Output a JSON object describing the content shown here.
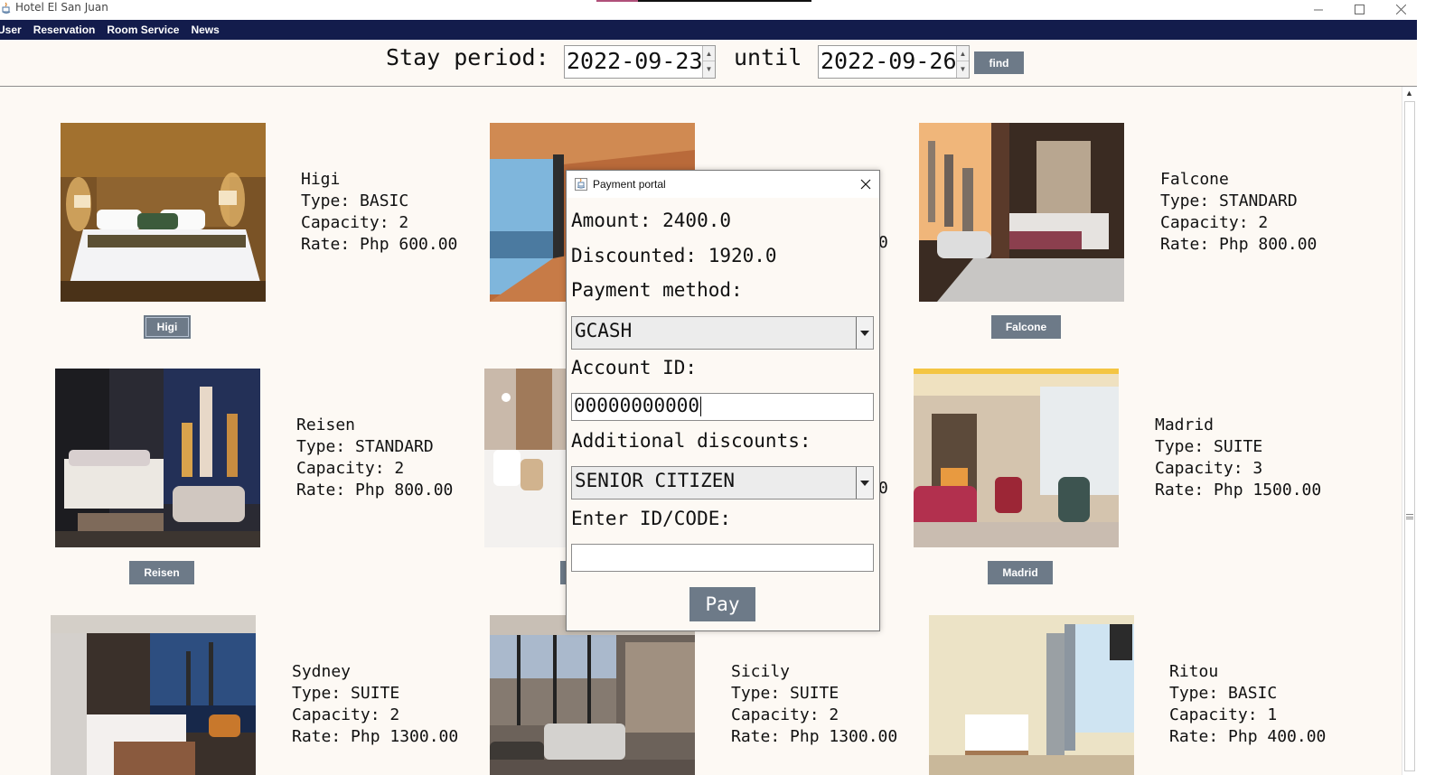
{
  "window": {
    "title": "Hotel El San Juan"
  },
  "menu": {
    "items": [
      "User",
      "Reservation",
      "Room Service",
      "News"
    ]
  },
  "search": {
    "stay_label": "Stay period:",
    "from_date": "2022-09-23",
    "until_label": "until",
    "to_date": "2022-09-26",
    "find_label": "find"
  },
  "rooms": [
    {
      "name": "Higi",
      "info": "Higi\nType: BASIC\nCapacity: 2\nRate: Php 600.00",
      "button": "Higi"
    },
    {
      "name": "Falcone",
      "info": "Falcone\nType: STANDARD\nCapacity: 2\nRate: Php 800.00",
      "button": "Falcone"
    },
    {
      "name": "Reisen",
      "info": "Reisen\nType: STANDARD\nCapacity: 2\nRate: Php 800.00",
      "button": "Reisen"
    },
    {
      "name": "Madrid",
      "info": "Madrid\nType: SUITE\nCapacity: 3\nRate: Php 1500.00",
      "button": "Madrid"
    },
    {
      "name": "Sydney",
      "info": "Sydney\nType: SUITE\nCapacity: 2\nRate: Php 1300.00"
    },
    {
      "name": "Sicily",
      "info": "Sicily\nType: SUITE\nCapacity: 2\nRate: Php 1300.00"
    },
    {
      "name": "Ritou",
      "info": "Ritou\nType: BASIC\nCapacity: 1\nRate: Php 400.00"
    }
  ],
  "hidden_fragments": {
    "row1": "0",
    "row2": "0"
  },
  "payment": {
    "title": "Payment portal",
    "amount": "Amount: 2400.0",
    "discounted": "Discounted: 1920.0",
    "method_label": "Payment method:",
    "method_value": "GCASH",
    "account_label": "Account ID:",
    "account_value": "00000000000",
    "discount_label": "Additional discounts:",
    "discount_value": "SENIOR CITIZEN",
    "code_label": "Enter ID/CODE:",
    "code_value": "",
    "pay_label": "Pay"
  },
  "colors": {
    "menubar": "#131c4c",
    "button": "#6d7a88",
    "background": "#fdf9f4"
  }
}
